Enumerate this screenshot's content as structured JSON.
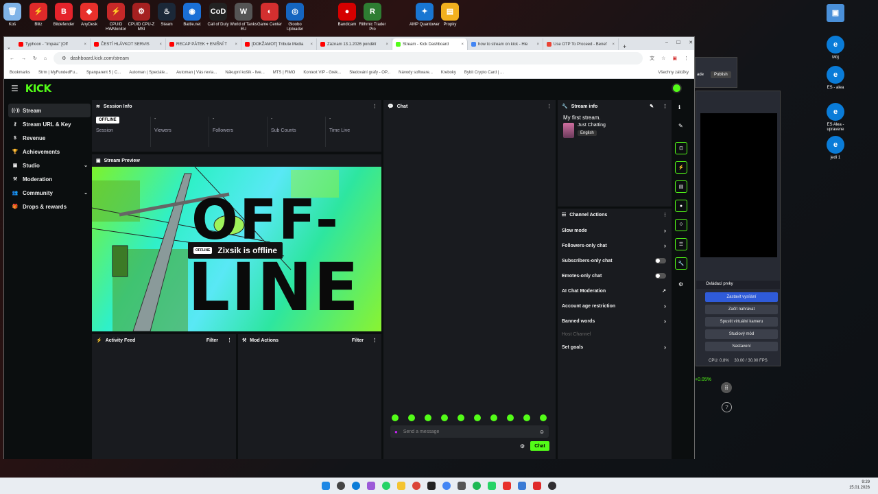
{
  "desktop": {
    "top_icons": [
      {
        "label": "Koš",
        "color": "#7fb3e8",
        "glyph": "🗑"
      },
      {
        "label": "Blitz",
        "color": "#e02a2a",
        "glyph": "⚡"
      },
      {
        "label": "Bitdefender",
        "color": "#e5232b",
        "glyph": "B"
      },
      {
        "label": "AnyDesk",
        "color": "#e8302b",
        "glyph": "◆"
      },
      {
        "label": "CPUID HWMonitor",
        "color": "#c62828",
        "glyph": "⚡"
      },
      {
        "label": "CPUID CPU-Z MSI",
        "color": "#a52020",
        "glyph": "⚙"
      },
      {
        "label": "Steam",
        "color": "#1b2838",
        "glyph": "♨"
      },
      {
        "label": "Battle.net",
        "color": "#1a6fd6",
        "glyph": "◉"
      },
      {
        "label": "Call of Duty",
        "color": "#222222",
        "glyph": "CoD"
      },
      {
        "label": "World of Tanks EU",
        "color": "#555555",
        "glyph": "W"
      },
      {
        "label": "Game Center",
        "color": "#d32f2f",
        "glyph": "◐"
      },
      {
        "label": "Gloobo Uploader",
        "color": "#1565c0",
        "glyph": "◎"
      },
      {
        "label": "Bandicam",
        "color": "#d50000",
        "glyph": "●"
      },
      {
        "label": "Rithmic Trader Pro",
        "color": "#2e7d32",
        "glyph": "R"
      },
      {
        "label": "AMP Quantower",
        "color": "#1976d2",
        "glyph": "✦"
      },
      {
        "label": "Propky",
        "color": "#f2b01e",
        "glyph": "▤"
      }
    ],
    "right_icons": [
      {
        "label": "",
        "glyph": "▣"
      },
      {
        "label": "Mój",
        "glyph": "e"
      },
      {
        "label": "ES - alea",
        "glyph": "e"
      },
      {
        "label": "ES Alea - upravene",
        "glyph": "e"
      },
      {
        "label": "jedi 1",
        "glyph": "e"
      }
    ]
  },
  "browser": {
    "tabs": [
      {
        "label": "Typhoon - \"Impala\" [Off",
        "color": "#ff0000"
      },
      {
        "label": "ČESTÍ HLÁVKOT SERVIS",
        "color": "#ff0000"
      },
      {
        "label": "RECAP PÁTEK + ENIŠNÍ T",
        "color": "#ff0000"
      },
      {
        "label": "[DOKŽAMOT] Tribute Media",
        "color": "#ff0000"
      },
      {
        "label": "Záznam 13.1.2026 pondělí",
        "color": "#ff0000"
      },
      {
        "label": "Stream - Kick Dashboard",
        "color": "#53fc18"
      },
      {
        "label": "how to stream on kick - Hle",
        "color": "#4285f4"
      },
      {
        "label": "Use OTP To Proceed - Benef",
        "color": "#ea4335"
      }
    ],
    "url": "dashboard.kick.com/stream",
    "bookmarks": [
      "Bookmarks",
      "Strm | MyFundedFu...",
      "Spanparent 5 | C...",
      "Automan | Speciále...",
      "Automan | Vás revía...",
      "Nákupní košík - live...",
      "MTS | FIMO",
      "Kontext VIP - Grek...",
      "Sledování grafy - OP...",
      "Návody software...",
      "Kreboky",
      "Bybit Crypto Card | ...",
      "Všechny záložky"
    ]
  },
  "kick": {
    "logo": "KICK",
    "nav": [
      {
        "label": "Stream",
        "icon": "stream-icon",
        "glyph": "((·))",
        "active": true,
        "chevron": false
      },
      {
        "label": "Stream URL & Key",
        "icon": "key-icon",
        "glyph": "⚷",
        "active": false,
        "chevron": false
      },
      {
        "label": "Revenue",
        "icon": "revenue-icon",
        "glyph": "$",
        "active": false,
        "chevron": false
      },
      {
        "label": "Achievements",
        "icon": "trophy-icon",
        "glyph": "🏆",
        "active": false,
        "chevron": false
      },
      {
        "label": "Studio",
        "icon": "studio-icon",
        "glyph": "▣",
        "active": false,
        "chevron": true
      },
      {
        "label": "Moderation",
        "icon": "hammer-icon",
        "glyph": "⚒",
        "active": false,
        "chevron": false
      },
      {
        "label": "Community",
        "icon": "community-icon",
        "glyph": "👥",
        "active": false,
        "chevron": true
      },
      {
        "label": "Drops & rewards",
        "icon": "gift-icon",
        "glyph": "🎁",
        "active": false,
        "chevron": false
      }
    ],
    "session_info": {
      "title": "Session Info",
      "status_badge": "OFFLINE",
      "stats": [
        {
          "value": "",
          "label": "Session"
        },
        {
          "value": "-",
          "label": "Viewers"
        },
        {
          "value": "-",
          "label": "Followers"
        },
        {
          "value": "-",
          "label": "Sub Counts"
        },
        {
          "value": "-",
          "label": "Time Live"
        }
      ]
    },
    "stream_preview": {
      "title": "Stream Preview",
      "badge": "OFFLINE",
      "offline_text": "Zixsik is offline",
      "art_line1": "OFF-",
      "art_line2": "LINE"
    },
    "activity_feed": {
      "title": "Activity Feed",
      "filter": "Filter"
    },
    "mod_actions": {
      "title": "Mod Actions",
      "filter": "Filter"
    },
    "chat": {
      "title": "Chat",
      "placeholder": "Send a message",
      "send_label": "Chat"
    },
    "stream_info": {
      "title": "Stream info",
      "stream_title": "My first stream.",
      "category": "Just Chatting",
      "language": "English"
    },
    "channel_actions": {
      "title": "Channel Actions",
      "rows": [
        {
          "label": "Slow mode",
          "control": "chevron"
        },
        {
          "label": "Followers-only chat",
          "control": "chevron"
        },
        {
          "label": "Subscribers-only chat",
          "control": "toggle"
        },
        {
          "label": "Emotes-only chat",
          "control": "toggle"
        },
        {
          "label": "AI Chat Moderation",
          "control": "external"
        },
        {
          "label": "Account age restriction",
          "control": "chevron"
        },
        {
          "label": "Banned words",
          "control": "chevron"
        },
        {
          "label": "Host Channel",
          "control": "none"
        },
        {
          "label": "Set goals",
          "control": "chevron"
        }
      ]
    },
    "accent": "#53fc18"
  },
  "obs": {
    "dock_title": "Ovládací prvky",
    "buttons": [
      "Zastavit vysílání",
      "Začít nahrávat",
      "Spustit virtuální kameru",
      "Studiový mód",
      "Nastavení"
    ],
    "status": "CPU: 0.8%",
    "fps": "30.00 / 30.00 FPS",
    "publish": "Publish",
    "mode_label": "ade",
    "percent": "+0.05%"
  },
  "taskbar": {
    "time": "9:29",
    "date": "15.01.2026"
  }
}
